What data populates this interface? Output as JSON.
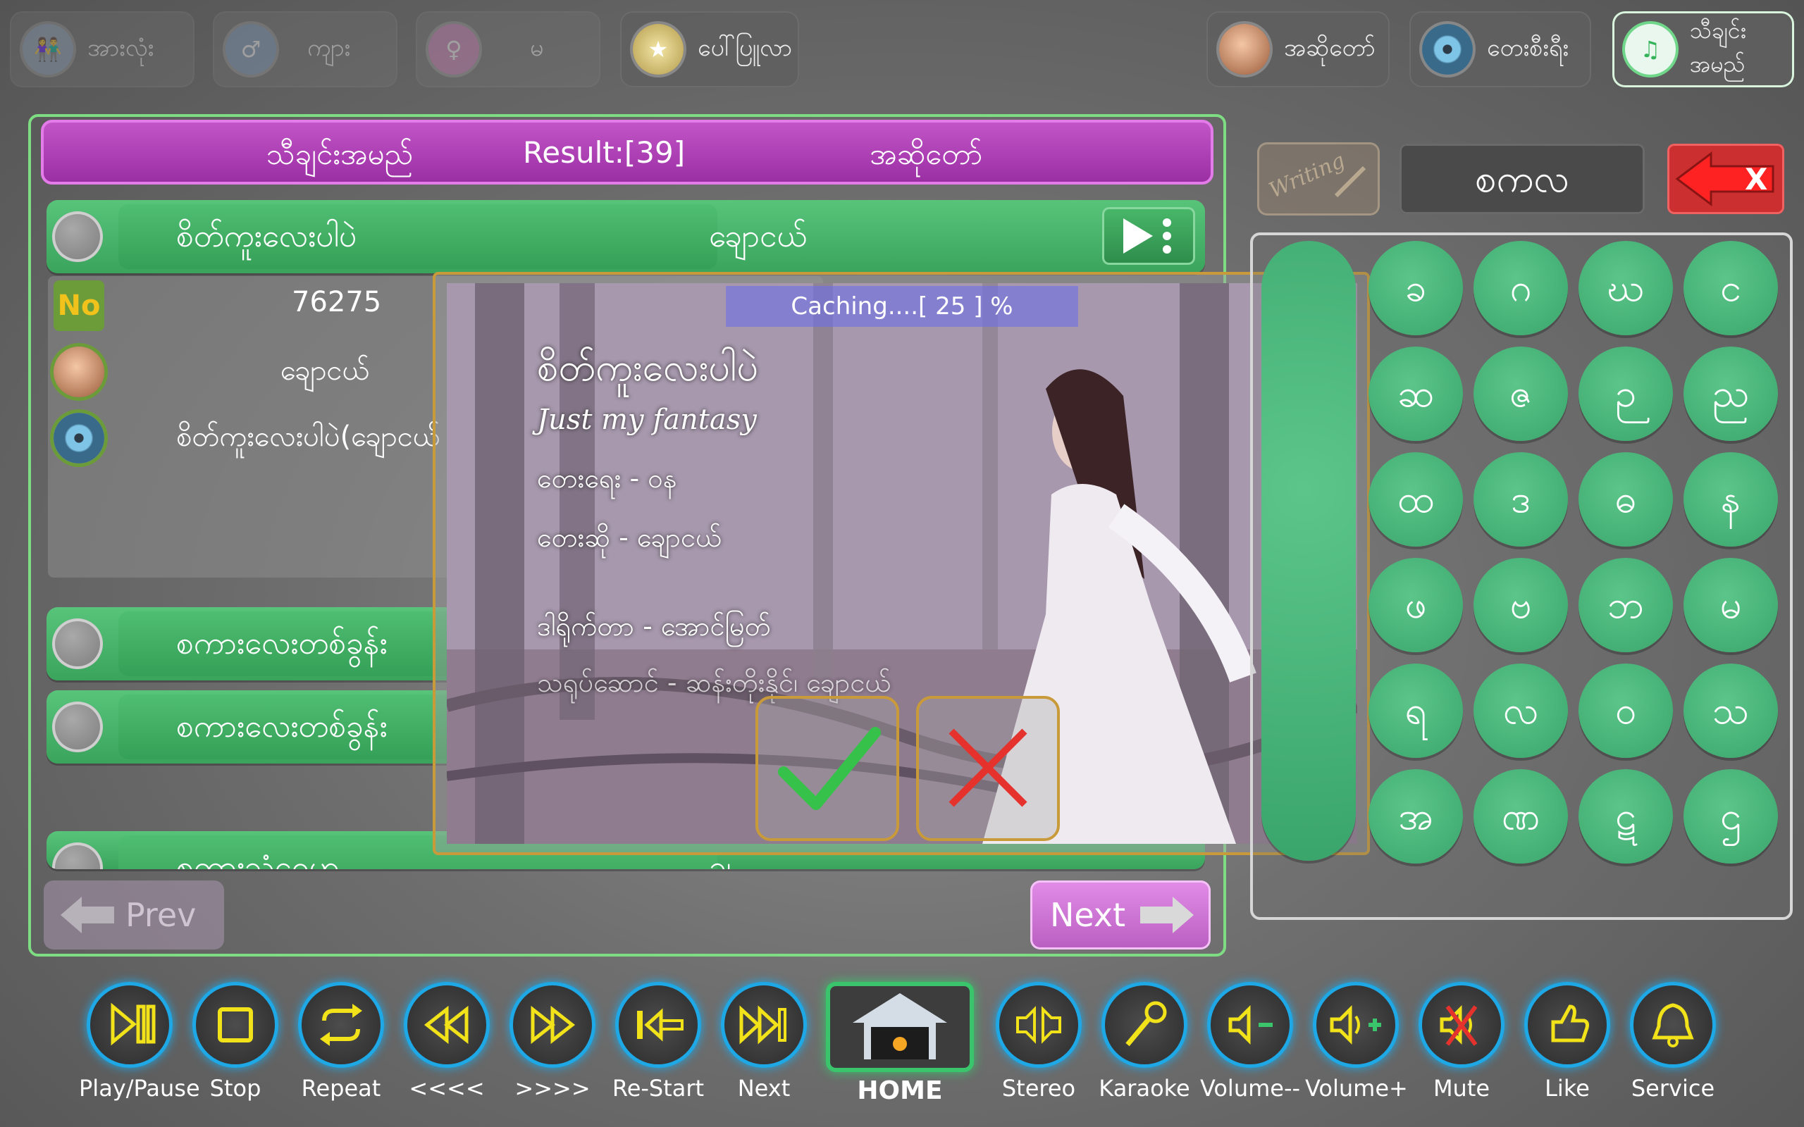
{
  "filters": {
    "all": "အားလုံး",
    "male": "ကျား",
    "female": "မ",
    "popular": "ပေါ်ပြူလာ",
    "artist": "အဆိုတော်",
    "album": "တေးစီးရီး",
    "song_name": "သီချင်းအမည်"
  },
  "list_header": {
    "song_col": "သီချင်းအမည်",
    "result": "Result:[39]",
    "artist_col": "အဆိုတော်"
  },
  "rows": [
    {
      "title": "စိတ်ကူးလေးပါပဲ",
      "artist": "ချောငယ်"
    },
    {
      "title": "စကားလေးတစ်ခွန်း",
      "artist": ""
    },
    {
      "title": "စကားလေးတစ်ခွန်း",
      "artist": ""
    },
    {
      "title": "စကားသံဂေဟ",
      "artist": "ချ"
    }
  ],
  "details": {
    "no_badge": "No",
    "number": "76275",
    "artist": "ချောငယ်",
    "album": "စိတ်ကူးလေးပါပဲ(ချောငယ်"
  },
  "nav": {
    "prev": "Prev",
    "next": "Next"
  },
  "overlay": {
    "caching": "Caching....[ 25 ] %",
    "song_title": "စိတ်ကူးလေးပါပဲ",
    "subtitle": "Just my fantasy",
    "composer": "တေးရေး - ဝန",
    "singer": "တေးဆို  - ချောငယ်",
    "director": "ဒါရိုက်တာ - အောင်မြတ်",
    "cinematographer": "သရုပ်ဆောင် - ဆန်းတိုးနိုင်၊ ချောငယ်"
  },
  "search": {
    "writing_label": "Writing",
    "query": "စကလ",
    "clear_label": "X"
  },
  "keypad": [
    "ခ",
    "ဂ",
    "ဃ",
    "င",
    "ဆ",
    "ဇ",
    "ဉ",
    "ည",
    "ထ",
    "ဒ",
    "ဓ",
    "န",
    "ဖ",
    "ဗ",
    "ဘ",
    "မ",
    "ရ",
    "လ",
    "ဝ",
    "သ",
    "အ",
    "ဏ",
    "ဋ",
    "ဌ"
  ],
  "toolbar": [
    {
      "label": "Play/Pause",
      "icon": "play-pause-icon"
    },
    {
      "label": "Stop",
      "icon": "stop-icon"
    },
    {
      "label": "Repeat",
      "icon": "repeat-icon"
    },
    {
      "label": "<<<<",
      "icon": "rewind-icon"
    },
    {
      "label": ">>>>",
      "icon": "fast-forward-icon"
    },
    {
      "label": "Re-Start",
      "icon": "restart-icon"
    },
    {
      "label": "Next",
      "icon": "next-track-icon"
    },
    {
      "label": "HOME",
      "icon": "home-icon"
    },
    {
      "label": "Stereo",
      "icon": "stereo-icon"
    },
    {
      "label": "Karaoke",
      "icon": "microphone-icon"
    },
    {
      "label": "Volume--",
      "icon": "volume-down-icon"
    },
    {
      "label": "Volume+",
      "icon": "volume-up-icon"
    },
    {
      "label": "Mute",
      "icon": "mute-icon"
    },
    {
      "label": "Like",
      "icon": "like-icon"
    },
    {
      "label": "Service",
      "icon": "bell-icon"
    }
  ],
  "colors": {
    "accent_green": "#3aa45d",
    "header_purple": "#a735af",
    "toolbar_ring": "#1ea8e6",
    "icon_yellow": "#f2e21a",
    "panel_border": "#7edc82"
  }
}
